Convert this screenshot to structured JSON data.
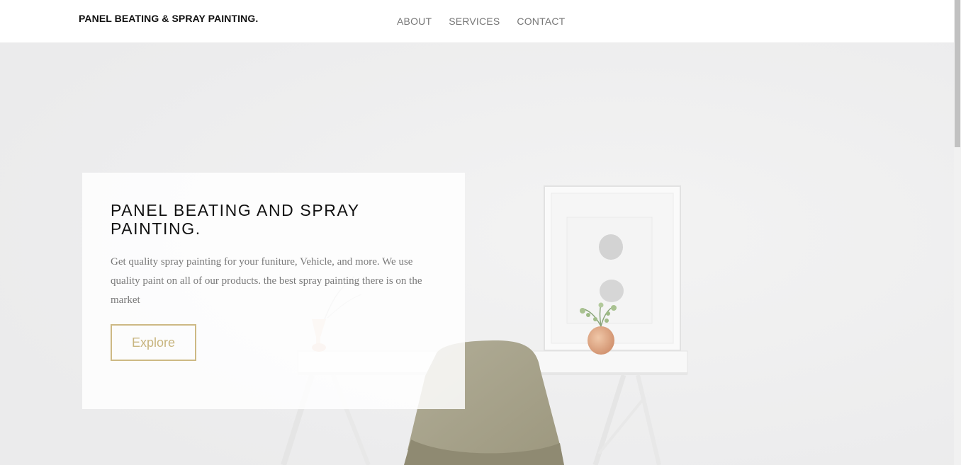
{
  "header": {
    "brand": "PANEL BEATING & SPRAY PAINTING.",
    "nav": [
      {
        "label": "ABOUT"
      },
      {
        "label": "SERVICES"
      },
      {
        "label": "CONTACT"
      }
    ]
  },
  "hero": {
    "title": "PANEL BEATING AND SPRAY PAINTING.",
    "description": "Get quality spray painting for your funiture, Vehicle, and more. We use quality paint on all of our products. the best spray painting there is on the market",
    "button_label": "Explore"
  },
  "colors": {
    "accent": "#cdb984",
    "text_dark": "#111111",
    "text_muted": "#7a7a7a",
    "nav_text": "#777777",
    "background": "#eeeeee"
  }
}
